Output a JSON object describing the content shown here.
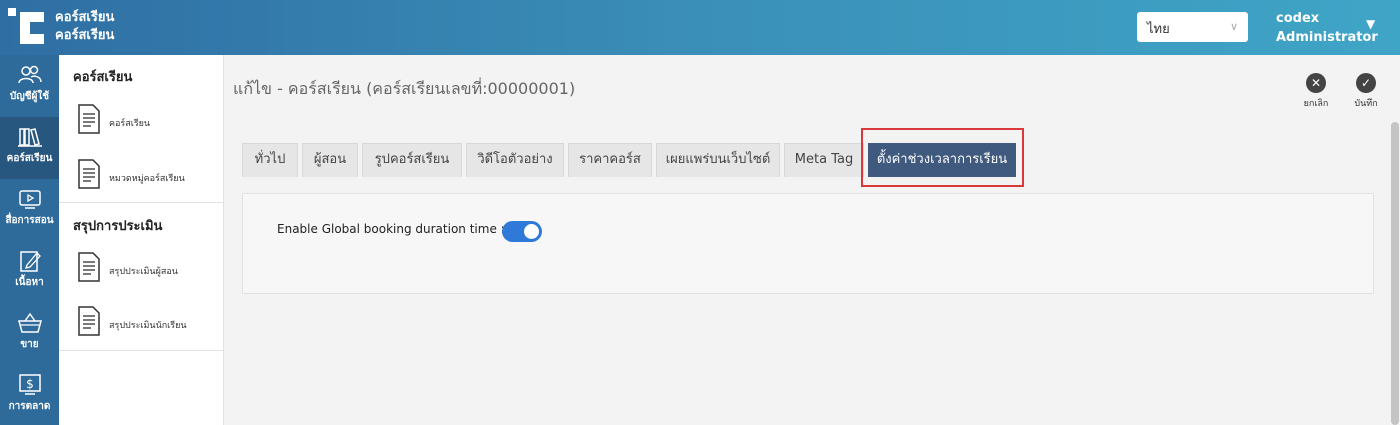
{
  "header": {
    "brand_line1": "คอร์สเรียน",
    "brand_line2": "คอร์สเรียน",
    "language": "ไทย",
    "user_name": "codex",
    "user_role": "Administrator",
    "gradient_start": "#2f6ea3",
    "gradient_end": "#3fa5c7"
  },
  "rail": [
    {
      "label": "บัญชีผู้ใช้",
      "icon": "users-icon"
    },
    {
      "label": "คอร์สเรียน",
      "icon": "books-icon"
    },
    {
      "label": "สื่อการสอน",
      "icon": "video-icon"
    },
    {
      "label": "เนื้อหา",
      "icon": "edit-icon"
    },
    {
      "label": "ขาย",
      "icon": "basket-icon"
    },
    {
      "label": "การตลาด",
      "icon": "dollar-monitor-icon"
    }
  ],
  "sidebar": {
    "section1": "คอร์สเรียน",
    "items1": [
      "คอร์สเรียน",
      "หมวดหมู่คอร์สเรียน"
    ],
    "section2": "สรุปการประเมิน",
    "items2": [
      "สรุปประเมินผู้สอน",
      "สรุปประเมินนักเรียน"
    ]
  },
  "main": {
    "title": "แก้ไข - คอร์สเรียน (คอร์สเรียนเลขที่:00000001)",
    "cancel_label": "ยกเลิก",
    "save_label": "บันทึก",
    "tabs": [
      "ทั่วไป",
      "ผู้สอน",
      "รูปคอร์สเรียน",
      "วิดีโอตัวอย่าง",
      "ราคาคอร์ส",
      "เผยแพร่บนเว็บไซต์",
      "Meta Tag",
      "ตั้งค่าช่วงเวลาการเรียน"
    ],
    "active_tab": "ตั้งค่าช่วงเวลาการเรียน",
    "option_label": "Enable Global booking duration time :",
    "toggle_on": true,
    "toggle_color": "#2f7ad9",
    "highlight_color": "#d9393b"
  }
}
